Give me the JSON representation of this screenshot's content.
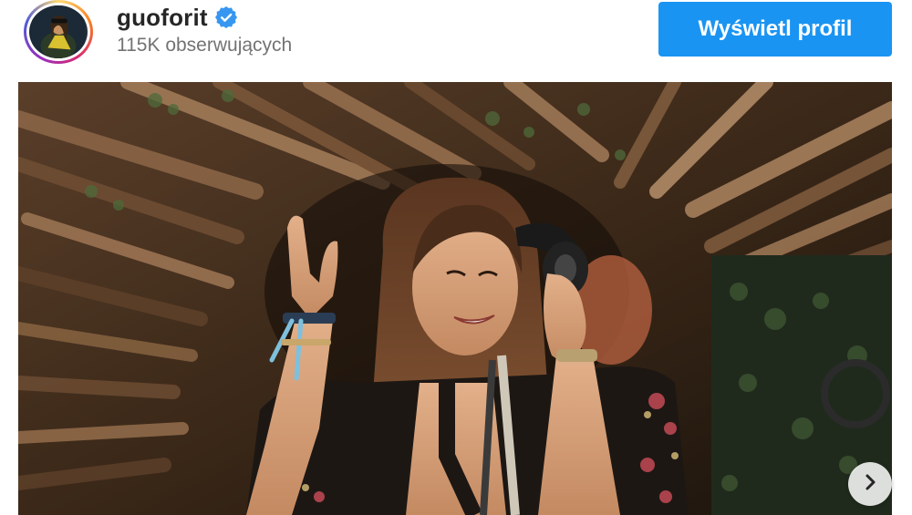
{
  "profile": {
    "username": "guoforit",
    "verified": true,
    "followers_text": "115K obserwujących",
    "avatar_icon": "profile-avatar"
  },
  "actions": {
    "view_profile_label": "Wyświetl profil"
  },
  "post": {
    "image_description_icon": "photo",
    "next_icon": "chevron-right-icon"
  },
  "colors": {
    "accent": "#1a94f2",
    "verified": "#3797f0",
    "username": "#262626",
    "secondary_text": "#737373"
  }
}
